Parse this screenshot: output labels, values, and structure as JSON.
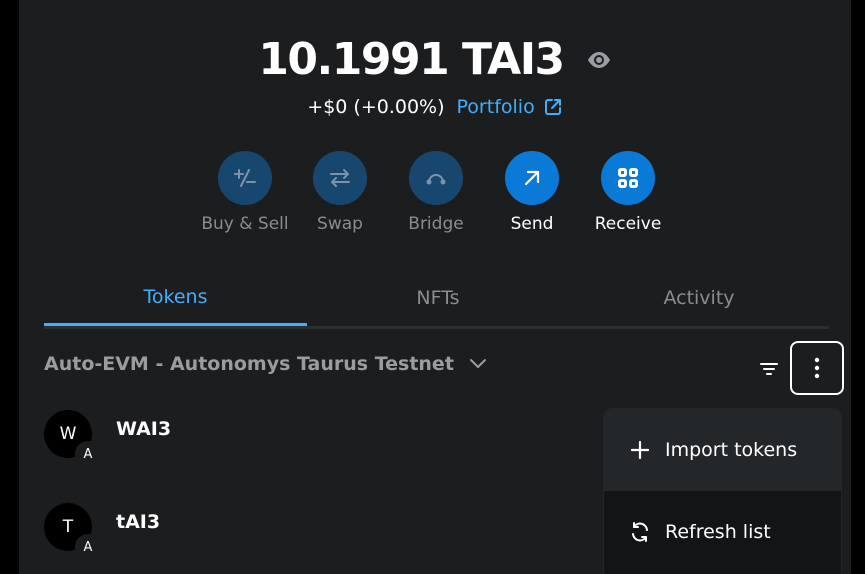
{
  "balance": {
    "amount": "10.1991 TAI3",
    "change": "+$0 (+0.00%)",
    "portfolio_label": "Portfolio"
  },
  "actions": [
    {
      "label": "Buy & Sell",
      "icon": "plus-minus-icon",
      "enabled": false
    },
    {
      "label": "Swap",
      "icon": "swap-arrows-icon",
      "enabled": false
    },
    {
      "label": "Bridge",
      "icon": "bridge-icon",
      "enabled": false
    },
    {
      "label": "Send",
      "icon": "arrow-up-right-icon",
      "enabled": true
    },
    {
      "label": "Receive",
      "icon": "qr-code-icon",
      "enabled": true
    }
  ],
  "tabs": [
    {
      "label": "Tokens",
      "active": true
    },
    {
      "label": "NFTs",
      "active": false
    },
    {
      "label": "Activity",
      "active": false
    }
  ],
  "network": {
    "name": "Auto-EVM - Autonomys Taurus Testnet"
  },
  "tokens": [
    {
      "symbol": "WAI3",
      "avatar_letter": "W",
      "badge_letter": "A"
    },
    {
      "symbol": "tAI3",
      "avatar_letter": "T",
      "badge_letter": "A"
    }
  ],
  "menu": {
    "items": [
      {
        "label": "Import tokens",
        "icon": "plus-icon"
      },
      {
        "label": "Refresh list",
        "icon": "refresh-icon"
      }
    ]
  },
  "colors": {
    "accent": "#43aefc",
    "button_enabled": "#0b79d6",
    "button_disabled": "#17476e",
    "panel_bg": "#1c1d1f",
    "muted_text": "#8a8c91"
  }
}
